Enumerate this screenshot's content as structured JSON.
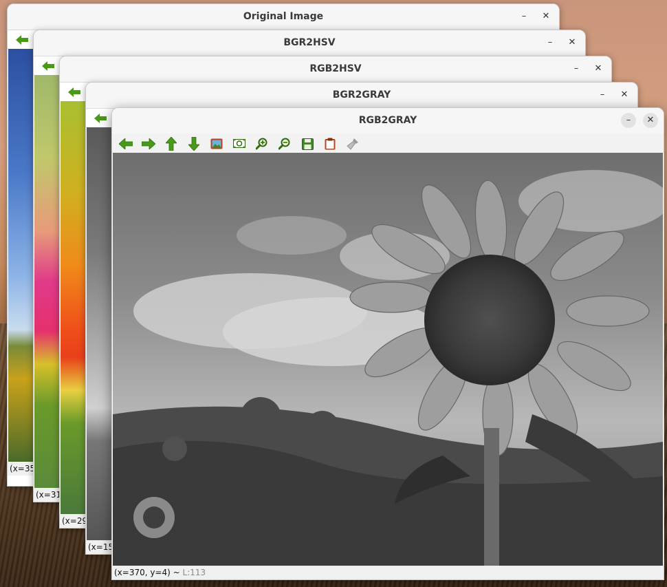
{
  "windows": [
    {
      "id": "original",
      "title": "Original Image",
      "status": "(x=35"
    },
    {
      "id": "bgr2hsv",
      "title": "BGR2HSV",
      "status": "(x=31"
    },
    {
      "id": "rgb2hsv",
      "title": "RGB2HSV",
      "status": "(x=29"
    },
    {
      "id": "bgr2gray",
      "title": "BGR2GRAY",
      "status": "(x=15"
    }
  ],
  "main": {
    "title": "RGB2GRAY",
    "status_coords": "(x=370, y=4) ~",
    "status_value": "L:113",
    "toolbar": [
      {
        "name": "back-arrow-icon",
        "icon": "arrow-left"
      },
      {
        "name": "forward-arrow-icon",
        "icon": "arrow-right"
      },
      {
        "name": "up-arrow-icon",
        "icon": "arrow-up"
      },
      {
        "name": "down-arrow-icon",
        "icon": "arrow-down"
      },
      {
        "name": "image-icon",
        "icon": "picture"
      },
      {
        "name": "zoom-fit-icon",
        "icon": "zoom-fit"
      },
      {
        "name": "zoom-in-icon",
        "icon": "zoom-in"
      },
      {
        "name": "zoom-out-icon",
        "icon": "zoom-out"
      },
      {
        "name": "save-icon",
        "icon": "floppy"
      },
      {
        "name": "copy-icon",
        "icon": "clipboard"
      },
      {
        "name": "properties-icon",
        "icon": "brush"
      }
    ]
  },
  "window_controls": {
    "minimize": "–",
    "close": "✕"
  },
  "colors": {
    "accent_green": "#4a9a1a"
  }
}
